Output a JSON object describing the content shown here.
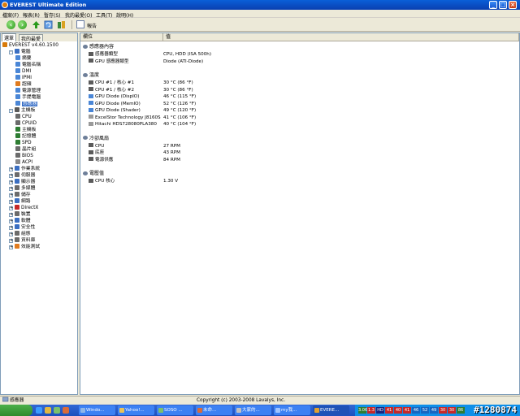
{
  "window": {
    "title": "EVEREST Ultimate Edition"
  },
  "menu": [
    "檔案(F)",
    "報表(R)",
    "暫存(S)",
    "我的最愛(O)",
    "工具(T)",
    "說明(H)"
  ],
  "toolbar": {
    "report_label": "報告"
  },
  "left_panel": {
    "tabs": [
      "選單",
      "我的最愛"
    ],
    "tree": [
      {
        "label": "EVEREST v4.60.1500",
        "indent": 0,
        "icon": "everest-icon",
        "expander": "",
        "color": "#d97b0a"
      },
      {
        "label": "電腦",
        "indent": 1,
        "icon": "computer-icon",
        "expander": "-",
        "color": "#3b6fc2"
      },
      {
        "label": "摘要",
        "indent": 2,
        "icon": "summary-icon",
        "expander": "",
        "color": "#4a86d6"
      },
      {
        "label": "電腦名稱",
        "indent": 2,
        "icon": "computer-name-icon",
        "expander": "",
        "color": "#4a86d6"
      },
      {
        "label": "DMI",
        "indent": 2,
        "icon": "dmi-icon",
        "expander": "",
        "color": "#4a86d6"
      },
      {
        "label": "IPMI",
        "indent": 2,
        "icon": "ipmi-icon",
        "expander": "",
        "color": "#4a86d6"
      },
      {
        "label": "超頻",
        "indent": 2,
        "icon": "overclock-icon",
        "expander": "",
        "color": "#e07b1f"
      },
      {
        "label": "電源管理",
        "indent": 2,
        "icon": "power-icon",
        "expander": "",
        "color": "#4a86d6"
      },
      {
        "label": "手提電腦",
        "indent": 2,
        "icon": "laptop-icon",
        "expander": "",
        "color": "#4a86d6"
      },
      {
        "label": "感應器",
        "indent": 2,
        "icon": "sensor-icon",
        "expander": "",
        "color": "#4a86d6",
        "selected": true
      },
      {
        "label": "主機板",
        "indent": 1,
        "icon": "motherboard-icon",
        "expander": "-",
        "color": "#5a5a5a"
      },
      {
        "label": "CPU",
        "indent": 2,
        "icon": "cpu-icon",
        "expander": "",
        "color": "#6b6b6b"
      },
      {
        "label": "CPUID",
        "indent": 2,
        "icon": "cpuid-icon",
        "expander": "",
        "color": "#6b6b6b"
      },
      {
        "label": "主機板",
        "indent": 2,
        "icon": "mainboard-icon",
        "expander": "",
        "color": "#2e7d32"
      },
      {
        "label": "記憶體",
        "indent": 2,
        "icon": "memory-icon",
        "expander": "",
        "color": "#2e7d32"
      },
      {
        "label": "SPD",
        "indent": 2,
        "icon": "spd-icon",
        "expander": "",
        "color": "#2e7d32"
      },
      {
        "label": "晶片組",
        "indent": 2,
        "icon": "chipset-icon",
        "expander": "",
        "color": "#6b6b6b"
      },
      {
        "label": "BIOS",
        "indent": 2,
        "icon": "bios-icon",
        "expander": "",
        "color": "#6b6b6b"
      },
      {
        "label": "ACPI",
        "indent": 2,
        "icon": "acpi-icon",
        "expander": "",
        "color": "#8a8a8a"
      },
      {
        "label": "作業系統",
        "indent": 1,
        "icon": "os-icon",
        "expander": "+",
        "color": "#3b6fc2"
      },
      {
        "label": "伺服器",
        "indent": 1,
        "icon": "server-icon",
        "expander": "+",
        "color": "#6b6b6b"
      },
      {
        "label": "顯示器",
        "indent": 1,
        "icon": "display-icon",
        "expander": "+",
        "color": "#3b6fc2"
      },
      {
        "label": "多媒體",
        "indent": 1,
        "icon": "multimedia-icon",
        "expander": "+",
        "color": "#6b6b6b"
      },
      {
        "label": "儲存",
        "indent": 1,
        "icon": "storage-icon",
        "expander": "+",
        "color": "#6b6b6b"
      },
      {
        "label": "網路",
        "indent": 1,
        "icon": "network-icon",
        "expander": "+",
        "color": "#3b6fc2"
      },
      {
        "label": "DirectX",
        "indent": 1,
        "icon": "directx-icon",
        "expander": "+",
        "color": "#c62828"
      },
      {
        "label": "裝置",
        "indent": 1,
        "icon": "devices-icon",
        "expander": "+",
        "color": "#6b6b6b"
      },
      {
        "label": "軟體",
        "indent": 1,
        "icon": "software-icon",
        "expander": "+",
        "color": "#3b6fc2"
      },
      {
        "label": "安全性",
        "indent": 1,
        "icon": "security-icon",
        "expander": "+",
        "color": "#3b6fc2"
      },
      {
        "label": "組態",
        "indent": 1,
        "icon": "config-icon",
        "expander": "+",
        "color": "#6b6b6b"
      },
      {
        "label": "資料庫",
        "indent": 1,
        "icon": "database-icon",
        "expander": "+",
        "color": "#6b6b6b"
      },
      {
        "label": "效能測試",
        "indent": 1,
        "icon": "benchmark-icon",
        "expander": "+",
        "color": "#e07b1f"
      }
    ]
  },
  "right_panel": {
    "columns": [
      "欄位",
      "值"
    ],
    "sections": [
      {
        "title": "感應器內容",
        "icon": "sensor-props-icon",
        "rows": [
          {
            "field": "感應器類型",
            "value": "CPU, HDD  (ISA 500h)",
            "icon": "sensor-type-icon"
          },
          {
            "field": "GPU 感應器類型",
            "value": "Diode  (ATI-Diode)",
            "icon": "gpu-sensor-icon"
          }
        ]
      },
      {
        "title": "溫度",
        "icon": "temperature-icon",
        "rows": [
          {
            "field": "CPU #1 / 核心 #1",
            "value": "30 °C  (86 °F)",
            "icon": "cpu-core-icon"
          },
          {
            "field": "CPU #1 / 核心 #2",
            "value": "30 °C  (86 °F)",
            "icon": "cpu-core-icon"
          },
          {
            "field": "GPU Diode (DispIO)",
            "value": "46 °C  (115 °F)",
            "icon": "gpu-icon"
          },
          {
            "field": "GPU Diode (MemIO)",
            "value": "52 °C  (126 °F)",
            "icon": "gpu-icon"
          },
          {
            "field": "GPU Diode (Shader)",
            "value": "49 °C  (120 °F)",
            "icon": "gpu-icon"
          },
          {
            "field": "ExcelStor Technology J8160S",
            "value": "41 °C  (106 °F)",
            "icon": "disk-icon"
          },
          {
            "field": "Hitachi HDS728080PLA380",
            "value": "40 °C  (104 °F)",
            "icon": "disk-icon"
          }
        ]
      },
      {
        "title": "冷卻風扇",
        "icon": "fan-icon",
        "rows": [
          {
            "field": "CPU",
            "value": "27 RPM",
            "icon": "cpu-fan-icon"
          },
          {
            "field": "底座",
            "value": "43 RPM",
            "icon": "chassis-fan-icon"
          },
          {
            "field": "電源供應",
            "value": "84 RPM",
            "icon": "psu-fan-icon"
          }
        ]
      },
      {
        "title": "電壓值",
        "icon": "voltage-icon",
        "rows": [
          {
            "field": "CPU 核心",
            "value": "1.30 V",
            "icon": "cpu-core-icon"
          }
        ]
      }
    ]
  },
  "status_bar": {
    "left": "感應器",
    "right": "Copyright (c) 2003-2008 Lavalys, Inc."
  },
  "taskbar": {
    "tasks": [
      "Windo...",
      "Yahoo!...",
      "SOSO ...",
      "未命...",
      "大家的...",
      "my我...",
      "EVERE..."
    ],
    "tray_values": [
      "3.06",
      "1.3",
      "HD",
      "41",
      "40",
      "41",
      "46",
      "52",
      "49",
      "30",
      "30",
      "86"
    ],
    "watermark": "#1280874"
  },
  "colors": {
    "titlebar": "#0a4fc8",
    "selection": "#316ac5",
    "taskbar": "#2458c5"
  }
}
